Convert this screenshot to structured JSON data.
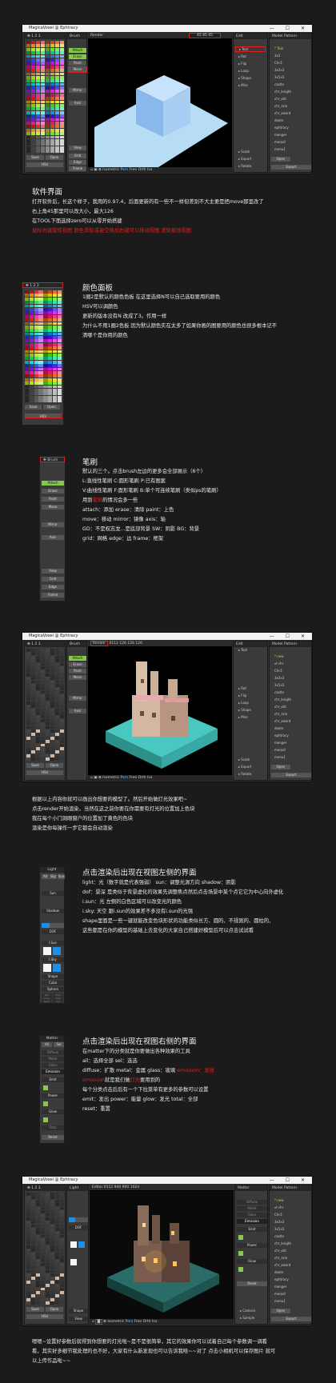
{
  "window_title": "MagicaVoxel @ Ephtracy",
  "window_controls": "— ☐ ✕",
  "ui": {
    "brush": "Brush",
    "render": "Render",
    "model": "Model",
    "pattern": "Pattern",
    "edit": "Edit",
    "tool": "Tool",
    "rot": "Rot",
    "flip": "Flip",
    "loop": "Loop",
    "shape": "Shape",
    "misc": "Misc",
    "scale": "Scale",
    "export": "Export",
    "rotate": "Rotate",
    "view": "View",
    "grid": "Grid",
    "edge": "Edge",
    "frame": "Frame",
    "hsv": "HSV",
    "save": "Save",
    "open": "Open",
    "new": "New",
    "attach": "Attach",
    "erase": "Erase",
    "paint": "Paint",
    "move": "Move",
    "mirror": "Mirror",
    "axis": "Axis",
    "isometric": "Isometric",
    "pers": "Pers",
    "free": "Free",
    "orth": "Orth",
    "iso": "Iso",
    "camera": "Camera",
    "sample": "Sample",
    "size1": "45 45 45",
    "size2": "126 126 126",
    "size3": "940 900",
    "size4": "1024",
    "count1": "0112",
    "count_scene": "Scene",
    "editor": "Editor",
    "matter": "Matter"
  },
  "model_list_1": [
    "* Tool",
    "3x3",
    "Chr3",
    "3x3x3",
    "3x5x3",
    "castle",
    "chr_knight",
    "chr_old",
    "chr_rain",
    "chr_sword",
    "doom",
    "ephtracy",
    "menger",
    "monu0",
    "monu1"
  ],
  "model_list_2": [
    "* new",
    "♂ chr",
    "Chr3",
    "3x3x3",
    "3x5x3",
    "castle",
    "chr_knight",
    "chr_old",
    "chr_rain",
    "chr_sword",
    "doom",
    "ephtracy",
    "menger",
    "monu0",
    "monu1"
  ],
  "light_panel": {
    "title": "Light",
    "tabs": [
      "All",
      "Sky",
      "Sun"
    ],
    "rows": [
      "Sun",
      "Shadow",
      "DOF",
      "I.Sun",
      "I.Sky",
      "Shape",
      "Cube",
      "Sphere"
    ],
    "bottom": [
      "Bpt",
      "Plan",
      "Cone",
      "Rnd",
      "Sphr",
      "Cyl"
    ]
  },
  "matter_panel": {
    "title": "Matter",
    "tabs": [
      "All",
      "Sel"
    ],
    "rows": [
      "Diffuse",
      "Metal",
      "Glass",
      "Emission",
      "Emit",
      "Power",
      "Glow",
      "Total",
      "Reset"
    ]
  },
  "sections": {
    "s1": {
      "title": "软件界面",
      "lines": [
        "打开软件后，长这个样子，我用的0.97.4，后面更新的有一些不一样但差别不大主要是把move那里改了",
        "右上角45那里可以改大小，最大126",
        "在TOOL下面选择zero可以从零开始搭建"
      ],
      "red": "鼠标右键旋转视图     颜色滑轮或者空格加右键可以移动视图     滚轮缩放视图"
    },
    "s2": {
      "title": "颜色面板",
      "lines": [
        "1圈2是默认的颜色色板 在这里选择N可以自己选取要用的颜色",
        "HSV可以调颜色",
        "更新的版本没有N 改成了3。作用一样",
        "为什么不用1圈2色板 因为默认颜色实在太多了如果你画的图要用的颜色也很多根本记不",
        "清哪个是你用的颜色"
      ]
    },
    "s3": {
      "title": "笔刷",
      "lines": [
        "默认的三个。点击brush左边的更多会全部展示（6个）",
        "L:直线性笔刷   C:圆形笔刷   P:已有图案",
        "V:曲线性笔刷   F:面形笔刷   B:单个可连续笔刷（类似ps的笔刷）",
        "用到_____的情况会多一些",
        "attach：添加    erase：清除    paint：上色",
        "move：移动    mirror：镜像    axis：轴",
        "GD：不是权志龙...是底部背景    SW：阴影    BG：背景",
        "grid：网格        edge：边          frame：框架"
      ],
      "red_word": "笔刷"
    },
    "s4": {
      "lines": [
        "根据以上内容你就可以画出你想要的模型了。然后开始做灯光效果吧~",
        "点击render开始渲染，当然在这之前你要在你需要有灯光的位置加上色块",
        "我在每个小门洞眼窗户的位置加了黄色的色块",
        "渲染是你每操作一步它都会自动渲染"
      ]
    },
    "s5": {
      "title": "点击渲染后出现在视图左侧的界面",
      "lines": [
        "light：光（数字就是代表强弱）   sun：调整光源方向    shadow：阴影",
        "dof：景深 是类似于背景虚化的效果先调整焦点然后点击场景中某个点它它为中心向外虚化",
        "i.sun：光 左侧的白色区域可以改变光的颜色",
        "i.sky: 天空 跟i.sun的效果差不多没有i.sun的光强",
        "shape里面是一些一键就能改变色块形状的功能类似长方、圆的、不规则的、圆柱的、",
        "这些都是在你的模型的基础上去变化的大家自己搭建好模型后可以点击试试看"
      ]
    },
    "s6": {
      "title": "点击渲染后出现在视图右侧的界面",
      "line1": "在matter下的分类就是你要做出各种效果的工具",
      "line2": "all：选择全部     sel：选选",
      "line3a": "diffuse：扩散    metal：金属     glass：玻璃      ",
      "line3b": "emission：发射",
      "line4a": "emission",
      "line4b": "就是我们做",
      "line4c": "灯光",
      "line4d": "要用到的",
      "line5": "每个分类点击后后有一个下拉菜单有更多的参数可以设置",
      "line6": "emit：发出      power：能量     glow：发光     total：全部",
      "line7": "reset：重置"
    },
    "s7": {
      "lines": [
        "嗯嗯~设置好参数后就得到你想要的灯光啦~是不是很简单，其它的效果你可以试着自己每个参数调一调看",
        "看，其实好多细节我处理的也不好，大家有什么新发现也可以告诉我哈~~对了 点击小相机可以保存图片 就可",
        "以上传作品啦~~"
      ]
    }
  },
  "colors": {
    "accent_green": "#86c94a",
    "highlight_red": "#e21b1b",
    "sky_blue": "#aed6f6",
    "cube_blue": "#8ec0f0",
    "teal": "#4bc7c1"
  }
}
